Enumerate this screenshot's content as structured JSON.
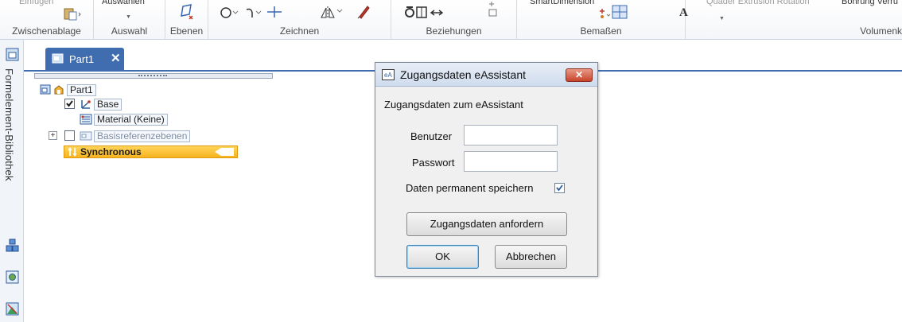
{
  "ribbon": {
    "top_tools": {
      "einfuegen": "Einfügen",
      "auswaehlen": "Auswählen",
      "smart_dimension": "SmartDimension",
      "features": "Quader  Extrusion  Rotation",
      "bohrung": "Bohrung  Verru"
    },
    "groups": {
      "zwischenablage": "Zwischenablage",
      "auswahl": "Auswahl",
      "ebenen": "Ebenen",
      "zeichnen": "Zeichnen",
      "beziehungen": "Beziehungen",
      "bemassen": "Bemaßen",
      "volumen": "Volumenk"
    }
  },
  "left_panel": {
    "library_label": "Formelement-Bibliothek"
  },
  "document": {
    "tab_label": "Part1",
    "tab_close": "✕"
  },
  "tree": {
    "root": "Part1",
    "base": "Base",
    "material": "Material (Keine)",
    "reference_planes": "Basisreferenzebenen",
    "synchronous": "Synchronous",
    "expand_symbol": "+"
  },
  "dialog": {
    "title": "Zugangsdaten eAssistant",
    "close_symbol": "✕",
    "heading": "Zugangsdaten zum eAssistant",
    "user_label": "Benutzer",
    "user_value": "",
    "password_label": "Passwort",
    "password_value": "",
    "save_label": "Daten permanent speichern",
    "save_checked": true,
    "request_button": "Zugangsdaten anfordern",
    "ok_button": "OK",
    "cancel_button": "Abbrechen"
  },
  "colors": {
    "tab_blue": "#3f6db0",
    "sync_yellow": "#f7b31f",
    "close_red": "#c6442b"
  }
}
